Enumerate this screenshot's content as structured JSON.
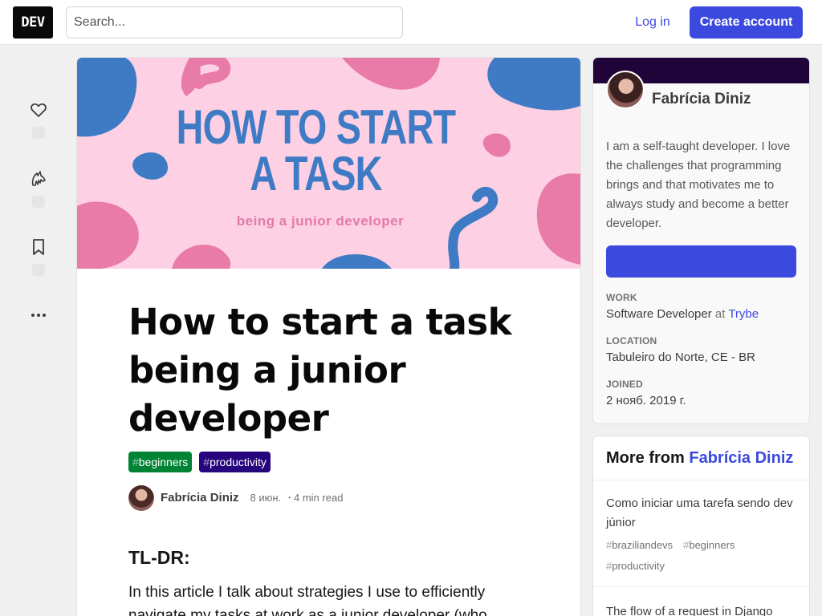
{
  "header": {
    "logo_text": "DEV",
    "search_placeholder": "Search...",
    "login_label": "Log in",
    "create_account_label": "Create account"
  },
  "reactions": [
    {
      "icon": "heart-icon"
    },
    {
      "icon": "unicorn-icon"
    },
    {
      "icon": "bookmark-icon"
    },
    {
      "icon": "more-horizontal-icon"
    }
  ],
  "cover": {
    "title_line1": "HOW TO START",
    "title_line2": "A TASK",
    "subtitle": "being a junior developer",
    "colors": {
      "background": "#fdd0e4",
      "blue": "#3f7bc4",
      "pink": "#e87ba8"
    }
  },
  "article": {
    "title": "How to start a task being a junior developer",
    "tags": [
      "beginners",
      "productivity"
    ],
    "author": "Fabrícia Diniz",
    "date": "8 июн.",
    "separator": "•",
    "read_time": "4 min read",
    "heading": "TL-DR:",
    "paragraph": "In this article I talk about strategies I use to efficiently navigate my tasks at work as a junior developer (who"
  },
  "profile": {
    "name": "Fabrícia Diniz",
    "bio": "I am a self-taught developer. I love the challenges that programming brings and that motivates me to always study and become a better developer.",
    "follow_label": "",
    "work_label": "WORK",
    "work_role": "Software Developer",
    "work_at": "at",
    "work_company": "Trybe",
    "location_label": "LOCATION",
    "location": "Tabuleiro do Norte, CE - BR",
    "joined_label": "JOINED",
    "joined": "2 нояб. 2019 г.",
    "band_color": "#200339"
  },
  "more_from": {
    "prefix": "More from",
    "author": "Fabrícia Diniz",
    "items": [
      {
        "title": "Como iniciar uma tarefa sendo dev júnior",
        "tags": [
          "braziliandevs",
          "beginners",
          "productivity"
        ]
      },
      {
        "title": "The flow of a request in Django",
        "tags": []
      }
    ]
  },
  "colors": {
    "accent": "#3b49df",
    "tag_beginners": "#008335",
    "tag_productivity": "#26057d"
  }
}
